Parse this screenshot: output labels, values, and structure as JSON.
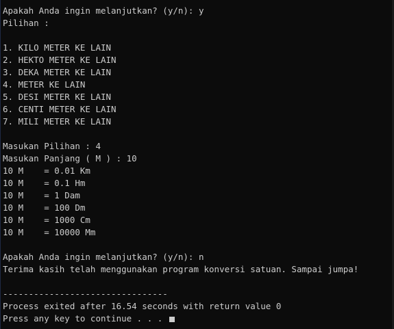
{
  "console": {
    "lines": [
      "Apakah Anda ingin melanjutkan? (y/n): y",
      "Pilihan :",
      "",
      "1. KILO METER KE LAIN",
      "2. HEKTO METER KE LAIN",
      "3. DEKA METER KE LAIN",
      "4. METER KE LAIN",
      "5. DESI METER KE LAIN",
      "6. CENTI METER KE LAIN",
      "7. MILI METER KE LAIN",
      "",
      "Masukan Pilihan : 4",
      "Masukan Panjang ( M ) : 10",
      "10 M    = 0.01 Km",
      "10 M    = 0.1 Hm",
      "10 M    = 1 Dam",
      "10 M    = 100 Dm",
      "10 M    = 1000 Cm",
      "10 M    = 10000 Mm",
      "",
      "Apakah Anda ingin melanjutkan? (y/n): n",
      "Terima kasih telah menggunakan program konversi satuan. Sampai jumpa!",
      "",
      "--------------------------------",
      "Process exited after 16.54 seconds with return value 0",
      "Press any key to continue . . . "
    ]
  },
  "colors": {
    "background": "#0c0c0c",
    "text": "#cccccc"
  }
}
